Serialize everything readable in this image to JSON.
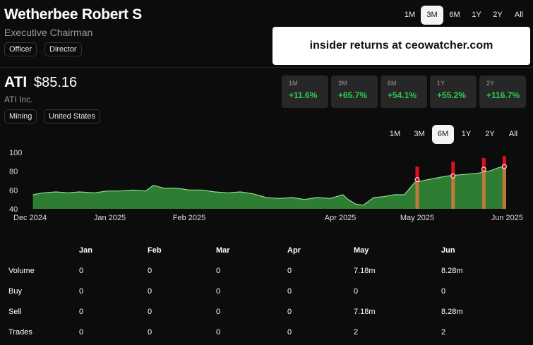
{
  "insider": {
    "name": "Wetherbee Robert S",
    "title": "Executive Chairman",
    "roles": [
      "Officer",
      "Director"
    ]
  },
  "top_ranges": [
    "1M",
    "3M",
    "6M",
    "1Y",
    "2Y",
    "All"
  ],
  "top_range_active": "3M",
  "promo": "insider returns at ceowatcher.com",
  "stock": {
    "ticker": "ATI",
    "price": "$85.16",
    "company": "ATI Inc.",
    "tags": [
      "Mining",
      "United States"
    ]
  },
  "returns": [
    {
      "period": "1M",
      "value": "+11.6%"
    },
    {
      "period": "3M",
      "value": "+65.7%"
    },
    {
      "period": "6M",
      "value": "+54.1%"
    },
    {
      "period": "1Y",
      "value": "+55.2%"
    },
    {
      "period": "2Y",
      "value": "+116.7%"
    }
  ],
  "chart_ranges": [
    "1M",
    "3M",
    "6M",
    "1Y",
    "2Y",
    "All"
  ],
  "chart_range_active": "6M",
  "colors": {
    "area_fill": "#2f7d32",
    "line": "#8be08e",
    "trade_bar": "#e0101a",
    "volume_bar": "#c07a3c",
    "positive": "#2ecc52"
  },
  "chart_data": {
    "type": "area",
    "y_ticks": [
      "100",
      "80",
      "60",
      "40"
    ],
    "ylim": [
      40,
      100
    ],
    "x_tick_labels": [
      "Dec 2024",
      "Jan 2025",
      "Feb 2025",
      "Apr 2025",
      "May 2025",
      "Jun 2025"
    ],
    "x_tick_dates": [
      "2024-12-01",
      "2025-01-01",
      "2025-02-01",
      "2025-04-01",
      "2025-05-01",
      "2025-06-01"
    ],
    "xlim": [
      "2024-12-01",
      "2025-06-05"
    ],
    "series": [
      {
        "x": [
          "2024-12-02",
          "2024-12-06",
          "2024-12-11",
          "2024-12-16",
          "2024-12-20",
          "2024-12-26",
          "2024-12-31",
          "2025-01-05",
          "2025-01-10",
          "2025-01-15",
          "2025-01-18",
          "2025-01-22",
          "2025-01-27",
          "2025-02-01",
          "2025-02-06",
          "2025-02-11",
          "2025-02-16",
          "2025-02-21",
          "2025-02-26",
          "2025-03-03",
          "2025-03-08",
          "2025-03-13",
          "2025-03-18",
          "2025-03-23",
          "2025-03-28",
          "2025-04-02",
          "2025-04-04",
          "2025-04-07",
          "2025-04-10",
          "2025-04-14",
          "2025-04-18",
          "2025-04-22",
          "2025-04-26",
          "2025-04-30",
          "2025-05-05",
          "2025-05-09",
          "2025-05-13",
          "2025-05-17",
          "2025-05-21",
          "2025-05-25",
          "2025-05-29",
          "2025-06-02",
          "2025-06-04"
        ],
        "y": [
          55,
          57,
          58,
          57,
          58,
          57,
          59,
          59,
          60,
          59,
          65,
          62,
          62,
          60,
          60,
          58,
          57,
          58,
          56,
          52,
          51,
          52,
          50,
          52,
          51,
          55,
          50,
          45,
          44,
          52,
          53,
          55,
          55,
          68,
          71,
          73,
          75,
          76,
          77,
          78,
          80,
          84,
          85
        ]
      }
    ],
    "trades": [
      {
        "x": "2025-05-01",
        "price": 71,
        "bar_top": 85
      },
      {
        "x": "2025-05-15",
        "price": 75,
        "bar_top": 90
      },
      {
        "x": "2025-05-27",
        "price": 82,
        "bar_top": 94
      },
      {
        "x": "2025-06-04",
        "price": 85,
        "bar_top": 96
      }
    ]
  },
  "table": {
    "columns": [
      "",
      "Jan",
      "Feb",
      "Mar",
      "Apr",
      "May",
      "Jun"
    ],
    "rows": [
      {
        "label": "Volume",
        "cells": [
          "0",
          "0",
          "0",
          "0",
          "7.18m",
          "8.28m"
        ]
      },
      {
        "label": "Buy",
        "cells": [
          "0",
          "0",
          "0",
          "0",
          "0",
          "0"
        ]
      },
      {
        "label": "Sell",
        "cells": [
          "0",
          "0",
          "0",
          "0",
          "7.18m",
          "8.28m"
        ]
      },
      {
        "label": "Trades",
        "cells": [
          "0",
          "0",
          "0",
          "0",
          "2",
          "2"
        ]
      }
    ]
  }
}
